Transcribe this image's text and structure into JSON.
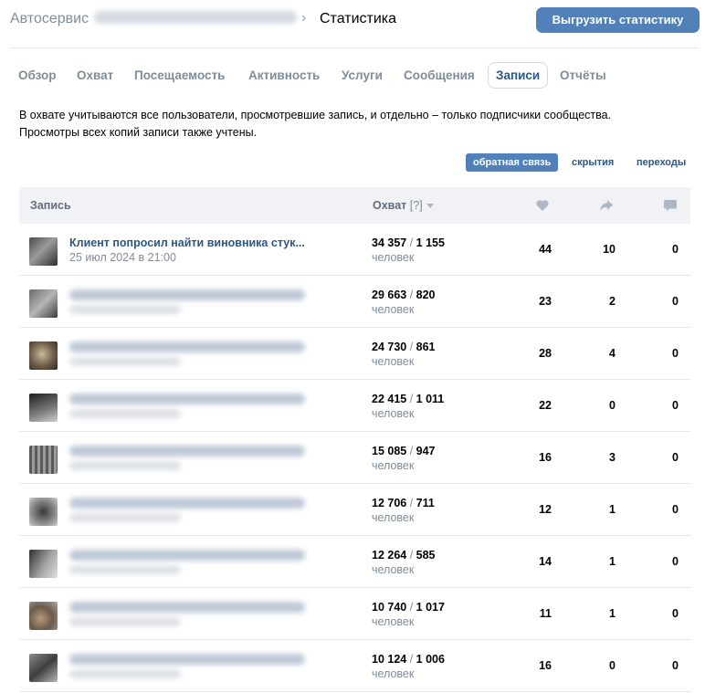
{
  "header": {
    "breadcrumb_root": "Автосервис",
    "breadcrumb_current": "Статистика",
    "export_button": "Выгрузить статистику"
  },
  "tabs": [
    {
      "label": "Обзор"
    },
    {
      "label": "Охват"
    },
    {
      "label": "Посещаемость"
    },
    {
      "label": "Активность"
    },
    {
      "label": "Услуги"
    },
    {
      "label": "Сообщения"
    },
    {
      "label": "Записи",
      "active": true
    },
    {
      "label": "Отчёты"
    }
  ],
  "notice": {
    "line1": "В охвате учитываются все пользователи, просмотревшие запись, и отдельно – только подписчики сообщества.",
    "line2": "Просмотры всех копий записи также учтены."
  },
  "filters": [
    {
      "label": "обратная связь",
      "active": true
    },
    {
      "label": "скрытия"
    },
    {
      "label": "переходы"
    }
  ],
  "table": {
    "col_post": "Запись",
    "col_reach": "Охват",
    "col_reach_hint": "[?]",
    "icons": [
      "heart-icon",
      "share-icon",
      "comment-icon"
    ],
    "unit": "человек",
    "rows": [
      {
        "title": "Клиент попросил найти виновника стук...",
        "date": "25 июл 2024 в 21:00",
        "reach_total": "34 357",
        "reach_subs": "1 155",
        "likes": "44",
        "shares": "10",
        "comments": "0"
      },
      {
        "title": "",
        "date": "",
        "reach_total": "29 663",
        "reach_subs": "820",
        "likes": "23",
        "shares": "2",
        "comments": "0"
      },
      {
        "title": "",
        "date": "",
        "reach_total": "24 730",
        "reach_subs": "861",
        "likes": "28",
        "shares": "4",
        "comments": "0"
      },
      {
        "title": "",
        "date": "",
        "reach_total": "22 415",
        "reach_subs": "1 011",
        "likes": "22",
        "shares": "0",
        "comments": "0"
      },
      {
        "title": "",
        "date": "",
        "reach_total": "15 085",
        "reach_subs": "947",
        "likes": "16",
        "shares": "3",
        "comments": "0"
      },
      {
        "title": "",
        "date": "",
        "reach_total": "12 706",
        "reach_subs": "711",
        "likes": "12",
        "shares": "1",
        "comments": "0"
      },
      {
        "title": "",
        "date": "",
        "reach_total": "12 264",
        "reach_subs": "585",
        "likes": "14",
        "shares": "1",
        "comments": "0"
      },
      {
        "title": "",
        "date": "",
        "reach_total": "10 740",
        "reach_subs": "1 017",
        "likes": "11",
        "shares": "1",
        "comments": "0"
      },
      {
        "title": "",
        "date": "",
        "reach_total": "10 124",
        "reach_subs": "1 006",
        "likes": "16",
        "shares": "0",
        "comments": "0"
      }
    ]
  },
  "colors": {
    "accent": "#5181b8",
    "link": "#2a5885",
    "muted": "#818c99",
    "header_bg": "#f0f2f5"
  }
}
